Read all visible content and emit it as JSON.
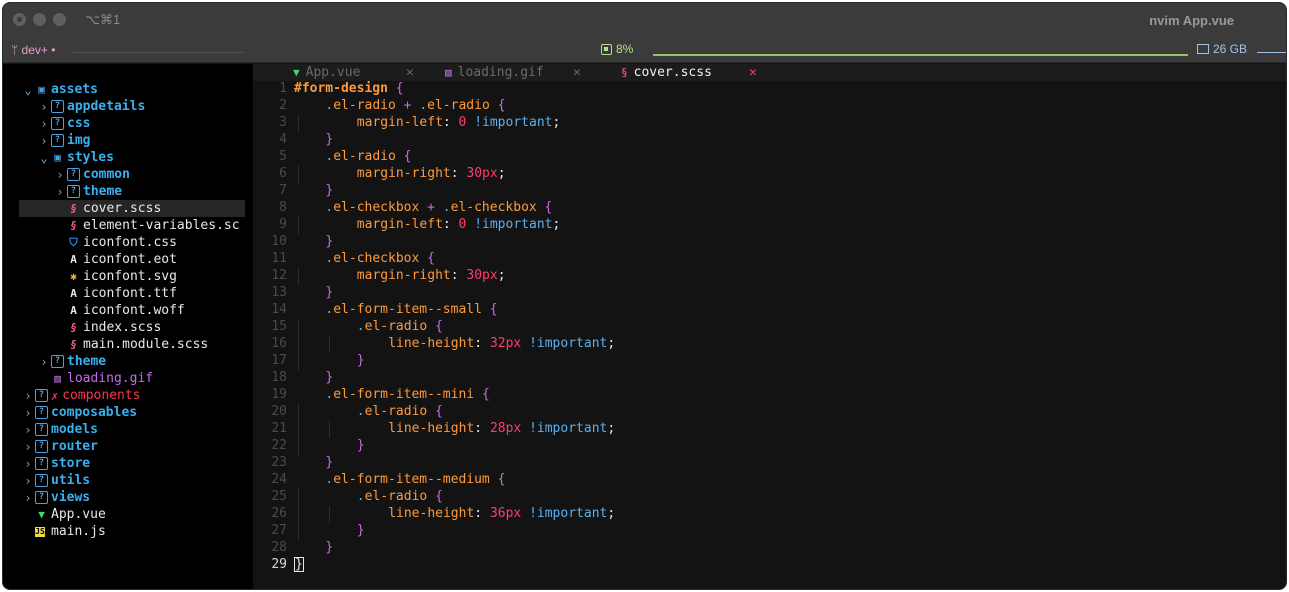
{
  "window": {
    "shortcut": "⌥⌘1",
    "title": "nvim App.vue"
  },
  "status": {
    "branch": "dev+ •",
    "cpu": "8%",
    "memory": "26 GB"
  },
  "tree": {
    "items": [
      {
        "label": "assets",
        "type": "folder-open",
        "depth": 0
      },
      {
        "label": "appdetails",
        "type": "folder",
        "depth": 1
      },
      {
        "label": "css",
        "type": "folder",
        "depth": 1
      },
      {
        "label": "img",
        "type": "folder",
        "depth": 1
      },
      {
        "label": "styles",
        "type": "folder-open",
        "depth": 1
      },
      {
        "label": "common",
        "type": "folder",
        "depth": 2
      },
      {
        "label": "theme",
        "type": "folder",
        "depth": 2
      },
      {
        "label": "cover.scss",
        "type": "sass",
        "depth": 2
      },
      {
        "label": "element-variables.sc",
        "type": "sass",
        "depth": 2
      },
      {
        "label": "iconfont.css",
        "type": "css",
        "depth": 2
      },
      {
        "label": "iconfont.eot",
        "type": "font",
        "depth": 2
      },
      {
        "label": "iconfont.svg",
        "type": "svg",
        "depth": 2
      },
      {
        "label": "iconfont.ttf",
        "type": "font",
        "depth": 2
      },
      {
        "label": "iconfont.woff",
        "type": "font",
        "depth": 2
      },
      {
        "label": "index.scss",
        "type": "sass",
        "depth": 2
      },
      {
        "label": "main.module.scss",
        "type": "sass",
        "depth": 2
      },
      {
        "label": "theme",
        "type": "folder",
        "depth": 1
      },
      {
        "label": "loading.gif",
        "type": "gif",
        "depth": 1
      },
      {
        "label": "components",
        "type": "folder-error",
        "depth": 0
      },
      {
        "label": "composables",
        "type": "folder",
        "depth": 0
      },
      {
        "label": "models",
        "type": "folder",
        "depth": 0
      },
      {
        "label": "router",
        "type": "folder",
        "depth": 0
      },
      {
        "label": "store",
        "type": "folder",
        "depth": 0
      },
      {
        "label": "utils",
        "type": "folder",
        "depth": 0
      },
      {
        "label": "views",
        "type": "folder",
        "depth": 0
      },
      {
        "label": "App.vue",
        "type": "vue",
        "depth": 0
      },
      {
        "label": "main.js",
        "type": "js",
        "depth": 0
      }
    ],
    "active_index": 7
  },
  "tabs": [
    {
      "label": "App.vue",
      "icon": "vue-icon",
      "active": false
    },
    {
      "label": "loading.gif",
      "icon": "image-icon",
      "active": false
    },
    {
      "label": "cover.scss",
      "icon": "sass-icon",
      "active": true
    }
  ],
  "tab_close_glyph": "✕",
  "code": {
    "current_line": 29,
    "lines": [
      {
        "n": "1",
        "indent": 0,
        "tokens": [
          [
            "sel",
            "#form-design"
          ],
          [
            "plain",
            " "
          ],
          [
            "brace",
            "{"
          ]
        ]
      },
      {
        "n": "2",
        "indent": 1,
        "tokens": [
          [
            "dot",
            "."
          ],
          [
            "cls",
            "el-radio"
          ],
          [
            "plain",
            " "
          ],
          [
            "plus",
            "+"
          ],
          [
            "plain",
            " "
          ],
          [
            "dot",
            "."
          ],
          [
            "cls",
            "el-radio"
          ],
          [
            "plain",
            " "
          ],
          [
            "brace",
            "{"
          ]
        ]
      },
      {
        "n": "3",
        "indent": 2,
        "tokens": [
          [
            "prop",
            "margin-left"
          ],
          [
            "plain",
            ": "
          ],
          [
            "num",
            "0"
          ],
          [
            "plain",
            " "
          ],
          [
            "imp",
            "!important"
          ],
          [
            "plain",
            ";"
          ]
        ]
      },
      {
        "n": "4",
        "indent": 1,
        "tokens": [
          [
            "brace",
            "}"
          ]
        ]
      },
      {
        "n": "5",
        "indent": 1,
        "tokens": [
          [
            "dot",
            "."
          ],
          [
            "cls",
            "el-radio"
          ],
          [
            "plain",
            " "
          ],
          [
            "brace",
            "{"
          ]
        ]
      },
      {
        "n": "6",
        "indent": 2,
        "tokens": [
          [
            "prop",
            "margin-right"
          ],
          [
            "plain",
            ": "
          ],
          [
            "num",
            "30px"
          ],
          [
            "plain",
            ";"
          ]
        ]
      },
      {
        "n": "7",
        "indent": 1,
        "tokens": [
          [
            "brace",
            "}"
          ]
        ]
      },
      {
        "n": "8",
        "indent": 1,
        "tokens": [
          [
            "dot",
            "."
          ],
          [
            "cls",
            "el-checkbox"
          ],
          [
            "plain",
            " "
          ],
          [
            "plus",
            "+"
          ],
          [
            "plain",
            " "
          ],
          [
            "dot",
            "."
          ],
          [
            "cls",
            "el-checkbox"
          ],
          [
            "plain",
            " "
          ],
          [
            "brace",
            "{"
          ]
        ]
      },
      {
        "n": "9",
        "indent": 2,
        "tokens": [
          [
            "prop",
            "margin-left"
          ],
          [
            "plain",
            ": "
          ],
          [
            "num",
            "0"
          ],
          [
            "plain",
            " "
          ],
          [
            "imp",
            "!important"
          ],
          [
            "plain",
            ";"
          ]
        ]
      },
      {
        "n": "10",
        "indent": 1,
        "tokens": [
          [
            "brace",
            "}"
          ]
        ]
      },
      {
        "n": "11",
        "indent": 1,
        "tokens": [
          [
            "dot",
            "."
          ],
          [
            "cls",
            "el-checkbox"
          ],
          [
            "plain",
            " "
          ],
          [
            "brace",
            "{"
          ]
        ]
      },
      {
        "n": "12",
        "indent": 2,
        "tokens": [
          [
            "prop",
            "margin-right"
          ],
          [
            "plain",
            ": "
          ],
          [
            "num",
            "30px"
          ],
          [
            "plain",
            ";"
          ]
        ]
      },
      {
        "n": "13",
        "indent": 1,
        "tokens": [
          [
            "brace",
            "}"
          ]
        ]
      },
      {
        "n": "14",
        "indent": 1,
        "tokens": [
          [
            "dot",
            "."
          ],
          [
            "cls",
            "el-form-item--small"
          ],
          [
            "plain",
            " "
          ],
          [
            "brace",
            "{"
          ]
        ]
      },
      {
        "n": "15",
        "indent": 2,
        "tokens": [
          [
            "dot",
            "."
          ],
          [
            "cls",
            "el-radio"
          ],
          [
            "plain",
            " "
          ],
          [
            "brace",
            "{"
          ]
        ]
      },
      {
        "n": "16",
        "indent": 3,
        "tokens": [
          [
            "prop",
            "line-height"
          ],
          [
            "plain",
            ": "
          ],
          [
            "num",
            "32px"
          ],
          [
            "plain",
            " "
          ],
          [
            "imp",
            "!important"
          ],
          [
            "plain",
            ";"
          ]
        ]
      },
      {
        "n": "17",
        "indent": 2,
        "tokens": [
          [
            "brace",
            "}"
          ]
        ]
      },
      {
        "n": "18",
        "indent": 1,
        "tokens": [
          [
            "brace",
            "}"
          ]
        ]
      },
      {
        "n": "19",
        "indent": 1,
        "tokens": [
          [
            "dot",
            "."
          ],
          [
            "cls",
            "el-form-item--mini"
          ],
          [
            "plain",
            " "
          ],
          [
            "brace",
            "{"
          ]
        ]
      },
      {
        "n": "20",
        "indent": 2,
        "tokens": [
          [
            "dot",
            "."
          ],
          [
            "cls",
            "el-radio"
          ],
          [
            "plain",
            " "
          ],
          [
            "brace",
            "{"
          ]
        ]
      },
      {
        "n": "21",
        "indent": 3,
        "tokens": [
          [
            "prop",
            "line-height"
          ],
          [
            "plain",
            ": "
          ],
          [
            "num",
            "28px"
          ],
          [
            "plain",
            " "
          ],
          [
            "imp",
            "!important"
          ],
          [
            "plain",
            ";"
          ]
        ]
      },
      {
        "n": "22",
        "indent": 2,
        "tokens": [
          [
            "brace",
            "}"
          ]
        ]
      },
      {
        "n": "23",
        "indent": 1,
        "tokens": [
          [
            "brace",
            "}"
          ]
        ]
      },
      {
        "n": "24",
        "indent": 1,
        "tokens": [
          [
            "dot",
            "."
          ],
          [
            "cls",
            "el-form-item--medium"
          ],
          [
            "plain",
            " "
          ],
          [
            "brace",
            "{"
          ]
        ]
      },
      {
        "n": "25",
        "indent": 2,
        "tokens": [
          [
            "dot",
            "."
          ],
          [
            "cls",
            "el-radio"
          ],
          [
            "plain",
            " "
          ],
          [
            "brace",
            "{"
          ]
        ]
      },
      {
        "n": "26",
        "indent": 3,
        "tokens": [
          [
            "prop",
            "line-height"
          ],
          [
            "plain",
            ": "
          ],
          [
            "num",
            "36px"
          ],
          [
            "plain",
            " "
          ],
          [
            "imp",
            "!important"
          ],
          [
            "plain",
            ";"
          ]
        ]
      },
      {
        "n": "27",
        "indent": 2,
        "tokens": [
          [
            "brace",
            "}"
          ]
        ]
      },
      {
        "n": "28",
        "indent": 1,
        "tokens": [
          [
            "brace",
            "}"
          ]
        ]
      },
      {
        "n": "29",
        "indent": 0,
        "tokens": [
          [
            "cursor",
            "}"
          ]
        ]
      }
    ]
  }
}
